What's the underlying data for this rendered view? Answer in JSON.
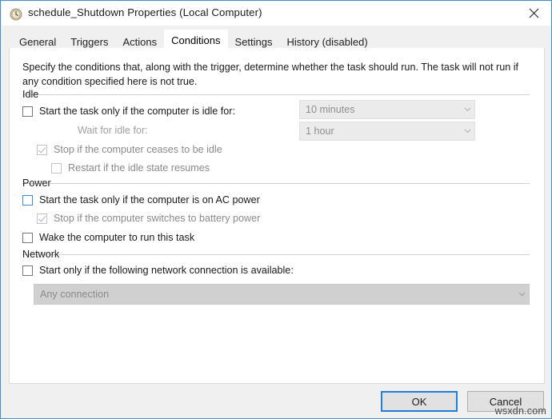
{
  "window": {
    "title": "schedule_Shutdown Properties (Local Computer)",
    "icon": "task-scheduler-clock-icon",
    "close_label": "✕",
    "accent": "#1e7fd4"
  },
  "tabs": [
    {
      "label": "General",
      "selected": false,
      "disabled": false
    },
    {
      "label": "Triggers",
      "selected": false,
      "disabled": false
    },
    {
      "label": "Actions",
      "selected": false,
      "disabled": false
    },
    {
      "label": "Conditions",
      "selected": true,
      "disabled": false
    },
    {
      "label": "Settings",
      "selected": false,
      "disabled": false
    },
    {
      "label": "History (disabled)",
      "selected": false,
      "disabled": true
    }
  ],
  "page": {
    "description": "Specify the conditions that, along with the trigger, determine whether the task should run.  The task will not run  if any condition specified here is not true.",
    "groups": {
      "idle": {
        "title": "Idle",
        "start_if_idle": {
          "label": "Start the task only if the computer is idle for:",
          "checked": false,
          "enabled": true
        },
        "idle_duration": {
          "value": "10 minutes",
          "enabled": false
        },
        "wait_for_idle_label": "Wait for idle for:",
        "wait_for_idle": {
          "value": "1 hour",
          "enabled": false
        },
        "stop_if_ceases": {
          "label": "Stop if the computer ceases to be idle",
          "checked": true,
          "enabled": false
        },
        "restart_if_resumes": {
          "label": "Restart if the idle state resumes",
          "checked": false,
          "enabled": false
        }
      },
      "power": {
        "title": "Power",
        "start_if_ac": {
          "label": "Start the task only if the computer is on AC power",
          "checked": false,
          "enabled": true,
          "focused": true
        },
        "stop_if_battery": {
          "label": "Stop if the computer switches to battery power",
          "checked": true,
          "enabled": false
        },
        "wake_computer": {
          "label": "Wake the computer to run this task",
          "checked": false,
          "enabled": true
        }
      },
      "network": {
        "title": "Network",
        "start_if_network": {
          "label": "Start only if the following network connection is available:",
          "checked": false,
          "enabled": true
        },
        "connection": {
          "value": "Any connection",
          "enabled": false
        }
      }
    }
  },
  "footer": {
    "ok_label": "OK",
    "cancel_label": "Cancel",
    "watermark": "wsxdn.com"
  }
}
